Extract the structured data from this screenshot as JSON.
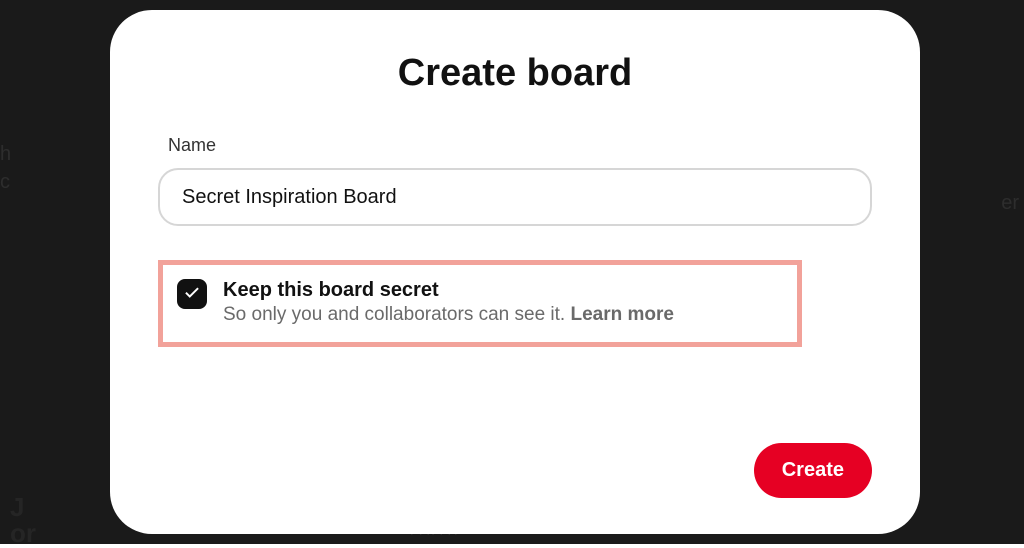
{
  "modal": {
    "title": "Create board",
    "name_label": "Name",
    "name_value": "Secret Inspiration Board",
    "secret": {
      "checked": true,
      "title": "Keep this board secret",
      "description": "So only you and collaborators can see it. ",
      "learn_more": "Learn more"
    },
    "create_button": "Create"
  }
}
